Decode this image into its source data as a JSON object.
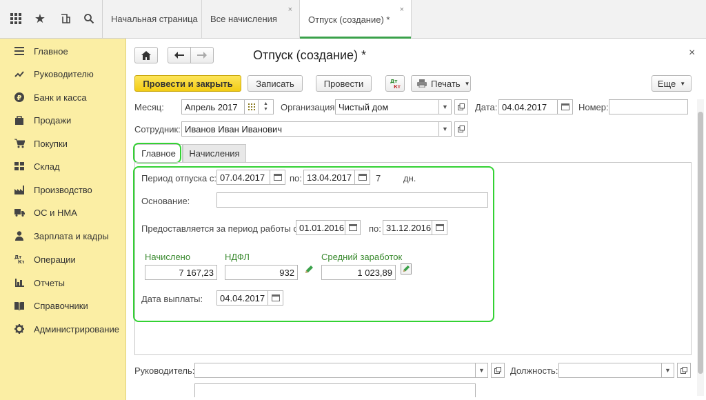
{
  "topbar": {
    "tabs": [
      {
        "label": "Начальная страница"
      },
      {
        "label": "Все начисления",
        "close": "×"
      },
      {
        "label": "Отпуск (создание) *",
        "close": "×"
      }
    ]
  },
  "sidebar": {
    "items": [
      {
        "label": "Главное",
        "icon": "menu-lines-icon"
      },
      {
        "label": "Руководителю",
        "icon": "chart-line-icon"
      },
      {
        "label": "Банк и касса",
        "icon": "ruble-coin-icon"
      },
      {
        "label": "Продажи",
        "icon": "bag-icon"
      },
      {
        "label": "Покупки",
        "icon": "cart-icon"
      },
      {
        "label": "Склад",
        "icon": "warehouse-icon"
      },
      {
        "label": "Производство",
        "icon": "factory-icon"
      },
      {
        "label": "ОС и НМА",
        "icon": "truck-icon"
      },
      {
        "label": "Зарплата и кадры",
        "icon": "person-icon"
      },
      {
        "label": "Операции",
        "icon": "dt-kt-icon"
      },
      {
        "label": "Отчеты",
        "icon": "bar-chart-icon"
      },
      {
        "label": "Справочники",
        "icon": "book-icon"
      },
      {
        "label": "Администрирование",
        "icon": "gear-icon"
      }
    ]
  },
  "form": {
    "title": "Отпуск (создание) *",
    "close": "×",
    "toolbar": {
      "post_close": "Провести и закрыть",
      "save": "Записать",
      "post": "Провести",
      "print": "Печать",
      "more": "Еще"
    },
    "month": {
      "label": "Месяц:",
      "value": "Апрель 2017"
    },
    "org": {
      "label": "Организация:",
      "value": "Чистый дом"
    },
    "date": {
      "label": "Дата:",
      "value": "04.04.2017"
    },
    "number": {
      "label": "Номер:",
      "value": ""
    },
    "employee": {
      "label": "Сотрудник:",
      "value": "Иванов Иван Иванович"
    },
    "tabs": {
      "main": "Главное",
      "accruals": "Начисления"
    },
    "period": {
      "label": "Период отпуска с:",
      "from": "07.04.2017",
      "to_label": "по:",
      "to": "13.04.2017",
      "days": "7",
      "days_unit": "дн."
    },
    "basis": {
      "label": "Основание:",
      "value": ""
    },
    "work_period": {
      "label": "Предоставляется за период работы с:",
      "from": "01.01.2016",
      "to_label": "по:",
      "to": "31.12.2016"
    },
    "accrued": {
      "label": "Начислено",
      "value": "7 167,23"
    },
    "ndfl": {
      "label": "НДФЛ",
      "value": "932"
    },
    "avg": {
      "label": "Средний заработок",
      "value": "1 023,89"
    },
    "pay_date": {
      "label": "Дата выплаты:",
      "value": "04.04.2017"
    },
    "manager": {
      "label": "Руководитель:",
      "value": ""
    },
    "position": {
      "label": "Должность:",
      "value": ""
    }
  },
  "colors": {
    "highlight": "#33d233",
    "sidebar": "#fbeea4",
    "primary_button": "#f3cc14",
    "green_text": "#3a8a2f"
  }
}
